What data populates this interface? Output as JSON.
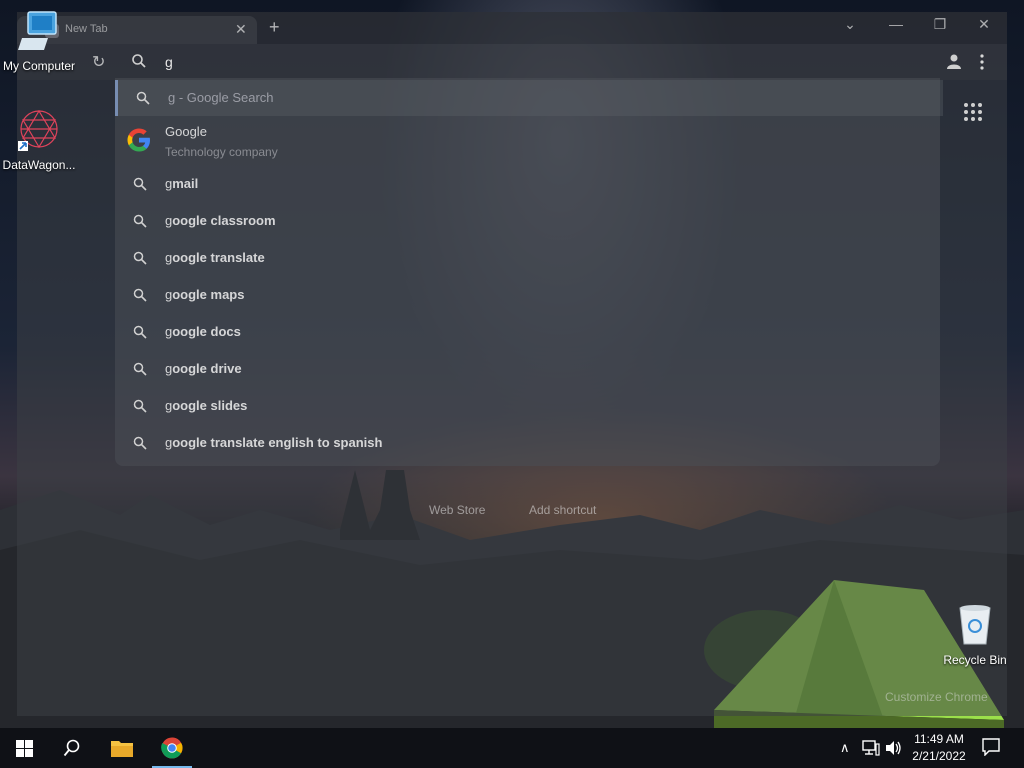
{
  "desktop": {
    "icons": [
      {
        "label": "My Computer"
      },
      {
        "label": "DataWagon..."
      },
      {
        "label": "Recycle Bin"
      }
    ]
  },
  "browser": {
    "tab": {
      "title": "New Tab"
    },
    "omnibox": {
      "value": "g"
    },
    "suggestions_first": {
      "query": "g",
      "suffix": " - Google Search"
    },
    "entity": {
      "name": "Google",
      "description": "Technology company"
    },
    "suggestions": [
      {
        "prefix": "g",
        "rest": "mail"
      },
      {
        "prefix": "g",
        "rest": "oogle classroom"
      },
      {
        "prefix": "g",
        "rest": "oogle translate"
      },
      {
        "prefix": "g",
        "rest": "oogle maps"
      },
      {
        "prefix": "g",
        "rest": "oogle docs"
      },
      {
        "prefix": "g",
        "rest": "oogle drive"
      },
      {
        "prefix": "g",
        "rest": "oogle slides"
      },
      {
        "prefix": "g",
        "rest": "oogle translate english to spanish"
      }
    ],
    "shortcuts": [
      {
        "label": "Web Store"
      },
      {
        "label": "Add shortcut"
      }
    ],
    "customize_label": "Customize Chrome"
  },
  "taskbar": {
    "clock": {
      "time": "11:49 AM",
      "date": "2/21/2022"
    },
    "apps": [
      {
        "icon": "start-icon"
      },
      {
        "icon": "search-icon"
      },
      {
        "icon": "file-explorer-icon"
      },
      {
        "icon": "chrome-icon"
      }
    ]
  },
  "colors": {
    "taskbar": "#0f1116",
    "active_indicator": "#76b9ed",
    "tent": "#9be04a"
  }
}
